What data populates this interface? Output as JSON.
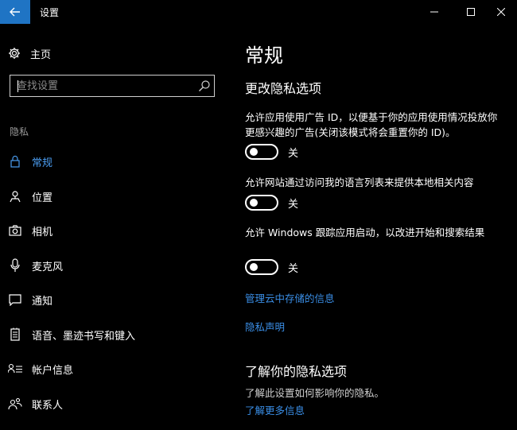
{
  "window": {
    "title": "设置"
  },
  "sidebar": {
    "home_label": "主页",
    "search_placeholder": "查找设置",
    "section_label": "隐私",
    "items": [
      {
        "label": "常规",
        "icon": "lock-icon",
        "active": true
      },
      {
        "label": "位置",
        "icon": "location-icon",
        "active": false
      },
      {
        "label": "相机",
        "icon": "camera-icon",
        "active": false
      },
      {
        "label": "麦克风",
        "icon": "microphone-icon",
        "active": false
      },
      {
        "label": "通知",
        "icon": "notification-icon",
        "active": false
      },
      {
        "label": "语音、墨迹书写和键入",
        "icon": "speech-icon",
        "active": false
      },
      {
        "label": "帐户信息",
        "icon": "account-info-icon",
        "active": false
      },
      {
        "label": "联系人",
        "icon": "contacts-icon",
        "active": false
      }
    ]
  },
  "main": {
    "title": "常规",
    "section_title": "更改隐私选项",
    "options": [
      {
        "text": "允许应用使用广告 ID，以便基于你的应用使用情况投放你更感兴趣的广告(关闭该模式将会重置你的 ID)。",
        "state": "关"
      },
      {
        "text": "允许网站通过访问我的语言列表来提供本地相关内容",
        "state": "关"
      },
      {
        "text": "允许 Windows 跟踪应用启动，以改进开始和搜索结果",
        "state": "关"
      }
    ],
    "links": {
      "manage_cloud": "管理云中存储的信息",
      "privacy_statement": "隐私声明"
    },
    "learn": {
      "title": "了解你的隐私选项",
      "desc": "了解此设置如何影响你的隐私。",
      "more_link": "了解更多信息"
    }
  },
  "colors": {
    "accent": "#1f74c4",
    "link": "#3a8ee6",
    "active_nav": "#4a9cf0",
    "background": "#000000"
  }
}
